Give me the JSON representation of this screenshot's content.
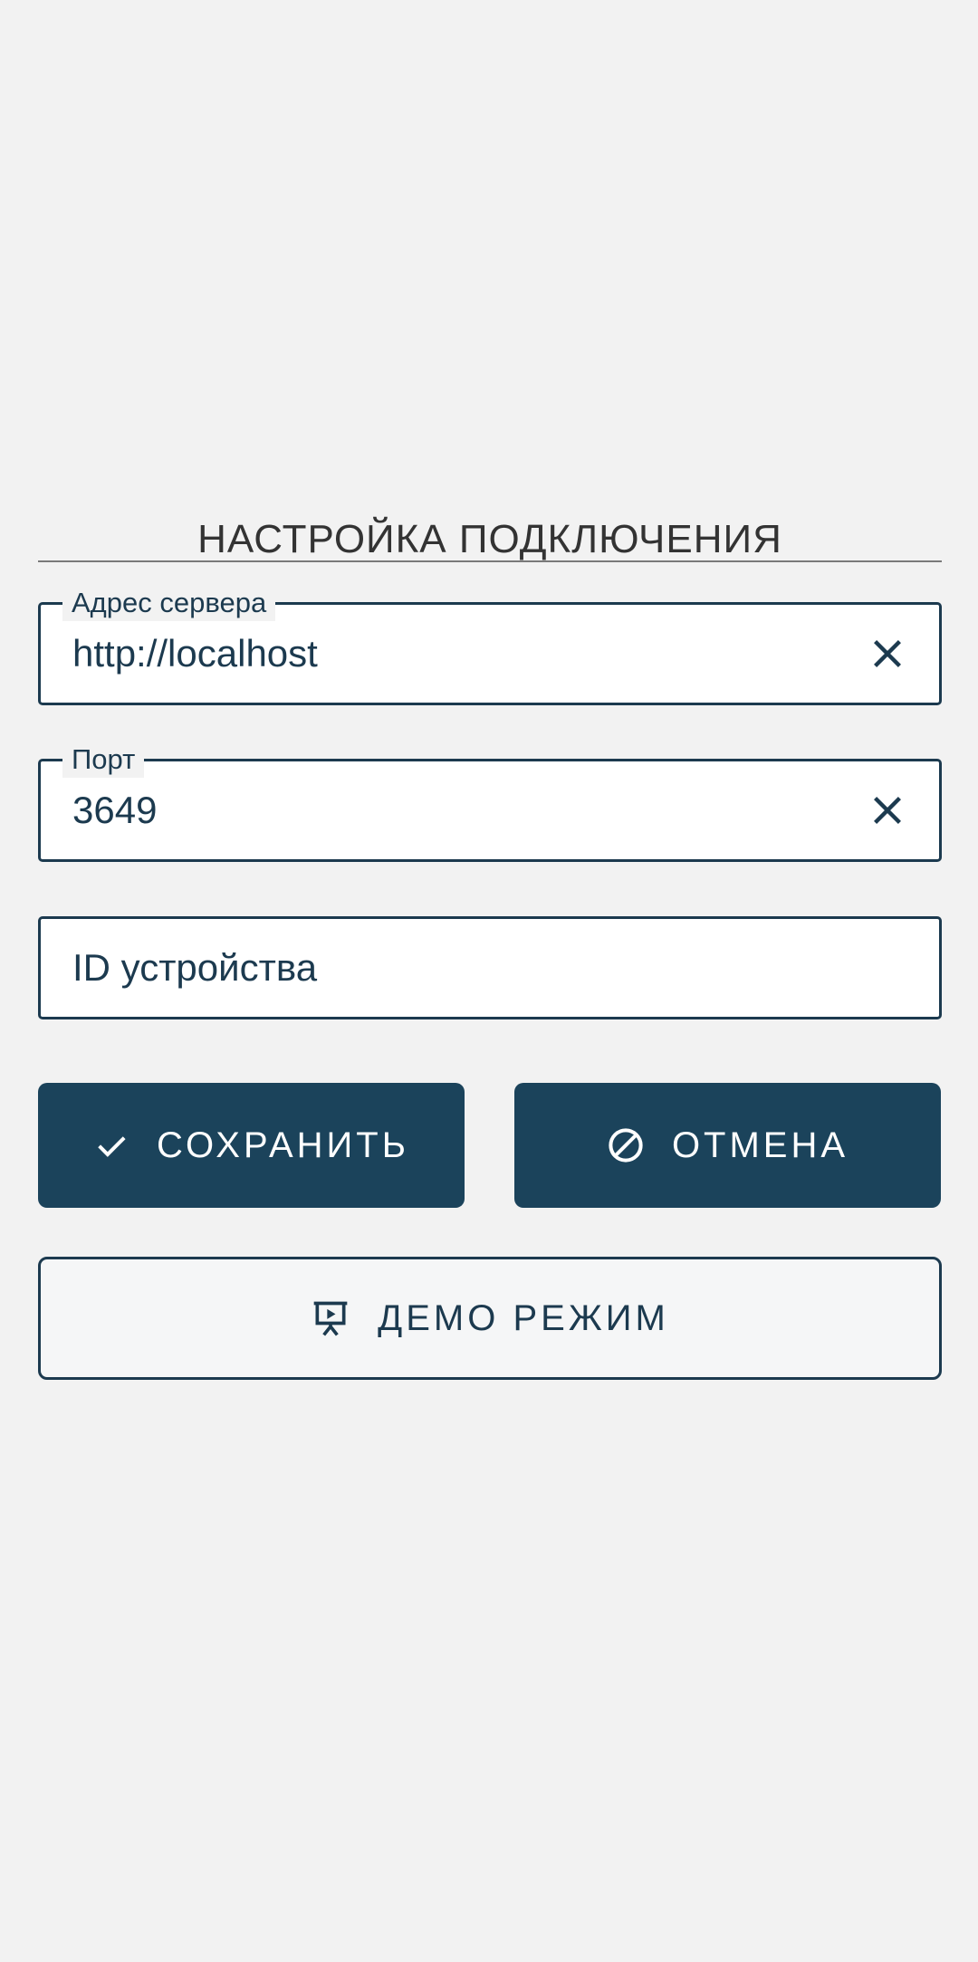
{
  "section": {
    "title": "НАСТРОЙКА ПОДКЛЮЧЕНИЯ"
  },
  "fields": {
    "server": {
      "label": "Адрес сервера",
      "value": "http://localhost",
      "clear_icon": "close-icon"
    },
    "port": {
      "label": "Порт",
      "value": "3649",
      "clear_icon": "close-icon"
    },
    "device_id": {
      "placeholder": "ID устройства",
      "value": ""
    }
  },
  "buttons": {
    "save": {
      "label": "СОХРАНИТЬ",
      "icon": "check-icon"
    },
    "cancel": {
      "label": "ОТМЕНА",
      "icon": "block-icon"
    },
    "demo": {
      "label": "ДЕМО РЕЖИМ",
      "icon": "presentation-icon"
    }
  },
  "colors": {
    "background": "#f2f2f2",
    "primary": "#1b435b",
    "text": "#1c3a4f",
    "title": "#333333"
  }
}
